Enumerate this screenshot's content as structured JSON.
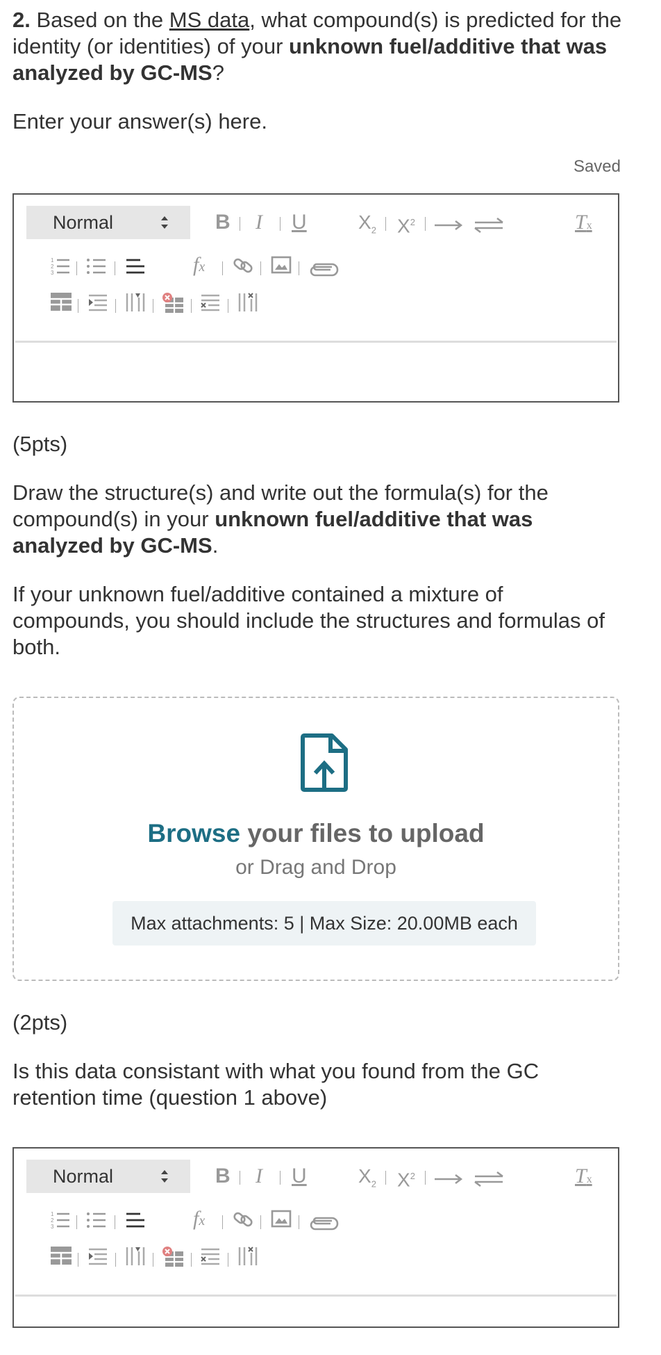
{
  "question2": {
    "number": "2.",
    "text_1": " Based on the ",
    "link": "MS data",
    "text_2": ", what compound(s) is predicted for the identity (or identities) of your ",
    "bold": "unknown fuel/additive that was analyzed by GC-MS",
    "text_3": "?"
  },
  "instruction": "Enter your answer(s) here.",
  "status": "Saved",
  "editor": {
    "format": "Normal",
    "icons": [
      "bold-icon",
      "italic-icon",
      "underline-icon",
      "subscript-icon",
      "superscript-icon",
      "arrow-icon",
      "equilibrium-arrow-icon",
      "clear-format-icon",
      "ordered-list-icon",
      "unordered-list-icon",
      "align-icon",
      "formula-icon",
      "link-icon",
      "image-icon",
      "attachment-icon",
      "table-icon",
      "insert-row-icon",
      "insert-column-icon",
      "delete-table-icon",
      "delete-row-icon",
      "delete-column-icon"
    ]
  },
  "points_1": "(5pts)",
  "draw": {
    "text_1": "Draw the structure(s) and write out the formula(s) for the compound(s) in your ",
    "bold": "unknown fuel/additive that was analyzed by GC-MS",
    "text_2": "."
  },
  "mixture_note": "If your unknown fuel/additive contained a mixture of compounds, you should include the structures and formulas of both.",
  "upload": {
    "browse": "Browse",
    "title_rest": " your files to upload",
    "subtitle": "or Drag and Drop",
    "limits": "Max attachments: 5 | Max Size: 20.00MB each"
  },
  "points_2": "(2pts)",
  "consistency_question": "Is this data consistant with what you found from the GC retention time (question 1 above)"
}
